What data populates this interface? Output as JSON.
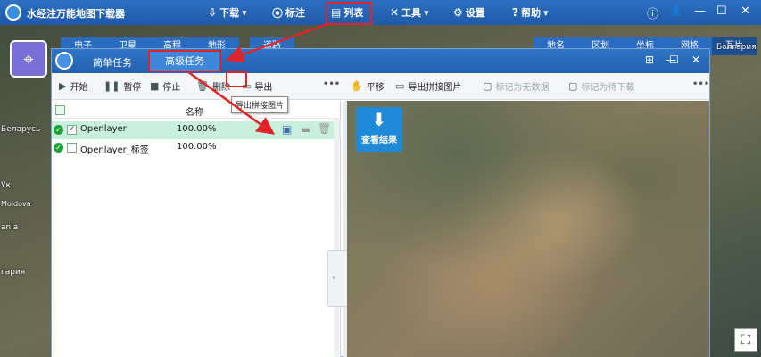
{
  "app": {
    "title": "水经注万能地图下载器"
  },
  "topbar": {
    "menu": [
      {
        "icon": "download-icon",
        "glyph": "⇩",
        "label": "下载",
        "caret": "▾"
      },
      {
        "icon": "pin-icon",
        "glyph": "⦿",
        "label": "标注",
        "caret": ""
      },
      {
        "icon": "list-icon",
        "glyph": "▤",
        "label": "列表",
        "caret": ""
      },
      {
        "icon": "tools-icon",
        "glyph": "✕",
        "label": "工具",
        "caret": "▾"
      },
      {
        "icon": "gear-icon",
        "glyph": "⚙",
        "label": "设置",
        "caret": ""
      },
      {
        "icon": "help-icon",
        "glyph": "?",
        "label": "帮助",
        "caret": "▾"
      }
    ],
    "window": {
      "info": "ⓘ",
      "user": "👤",
      "min": "—",
      "max": "☐",
      "close": "✕"
    }
  },
  "map_tabs_left": [
    "电子",
    "卫星",
    "高程",
    "地形",
    "道路"
  ],
  "map_tabs_right": [
    "地名",
    "区划",
    "坐标",
    "网格",
    "瓦片"
  ],
  "map_labels": [
    {
      "text": "Беларусь"
    },
    {
      "text": "Ук"
    },
    {
      "text": "Moldova"
    },
    {
      "text": "ania"
    },
    {
      "text": "гария"
    },
    {
      "text": "Болгария"
    }
  ],
  "window": {
    "tabs": {
      "simple": "简单任务",
      "advanced": "高级任务"
    },
    "controls": {
      "pin": "⊞",
      "min": "—",
      "max": "☐",
      "close": "✕"
    }
  },
  "toolbar": {
    "start": "开始",
    "pause": "暂停",
    "stop": "停止",
    "delete": "删除",
    "export": "导出",
    "more": "•••",
    "pan": "平移",
    "export_mosaic": "导出拼接图片",
    "mark_no_data": "标记为无数据",
    "mark_pending": "标记为待下载",
    "more2": "•••"
  },
  "task_list": {
    "header": "名称",
    "rows": [
      {
        "name": "Openlayer",
        "progress": "100.00%",
        "checked": "✓",
        "selected": true
      },
      {
        "name": "Openlayer_标签",
        "progress": "100.00%",
        "checked": "",
        "selected": false
      }
    ],
    "tooltip": "导出拼接图片"
  },
  "map_view": {
    "view_result": "查看结果"
  },
  "colors": {
    "highlight": "#e0252a",
    "topbar": "#2464b2",
    "selected_row": "#c9f0df"
  }
}
